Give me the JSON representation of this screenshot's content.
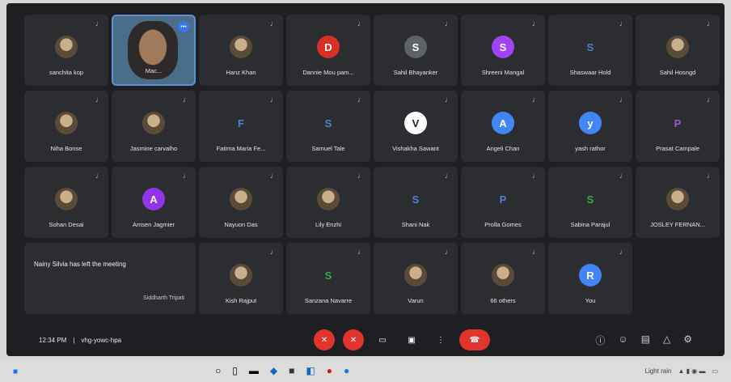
{
  "tiles": [
    {
      "name": "sanchita kop",
      "avatar": "",
      "kind": "photo"
    },
    {
      "name": "Mac...",
      "avatar": "",
      "kind": "self"
    },
    {
      "name": "Hanz Khan",
      "avatar": "",
      "kind": "photo"
    },
    {
      "name": "Dannie Mou pam...",
      "avatar": "D",
      "color": "#d93025"
    },
    {
      "name": "Sahil Bhayanker",
      "avatar": "S",
      "color": "#5f6368"
    },
    {
      "name": "Shreeni Mangal",
      "avatar": "S",
      "color": "#a142f4"
    },
    {
      "name": "Shaswaar Hold",
      "avatar": "S",
      "kind": "plain"
    },
    {
      "name": "Sahil Hosngd",
      "avatar": "",
      "kind": "photo"
    },
    {
      "name": "Niha Bonse",
      "avatar": "",
      "kind": "photo"
    },
    {
      "name": "Jasmine carvalho",
      "avatar": "",
      "kind": "photo"
    },
    {
      "name": "Fatima Maria Fe...",
      "avatar": "F",
      "kind": "plain"
    },
    {
      "name": "Samuel Tale",
      "avatar": "S",
      "kind": "plain"
    },
    {
      "name": "Vishakha Sawant",
      "avatar": "V",
      "color": "#ffffff",
      "textColor": "#222"
    },
    {
      "name": "Angeli Chan",
      "avatar": "A",
      "color": "#4285f4"
    },
    {
      "name": "yash rathor",
      "avatar": "y",
      "color": "#4285f4"
    },
    {
      "name": "Prasat Campale",
      "avatar": "P",
      "kind": "plain",
      "textColor": "#9b59d6"
    },
    {
      "name": "Sohan Desai",
      "avatar": "",
      "kind": "photo"
    },
    {
      "name": "Amsen Jagmier",
      "avatar": "A",
      "color": "#9334e6"
    },
    {
      "name": "Nayuon Das",
      "avatar": "",
      "kind": "photo"
    },
    {
      "name": "Lily Enzhi",
      "avatar": "",
      "kind": "photo"
    },
    {
      "name": "Shani Nak",
      "avatar": "S",
      "kind": "plain"
    },
    {
      "name": "Prolla Gomes",
      "avatar": "P",
      "kind": "plain"
    },
    {
      "name": "Sabina Parajul",
      "avatar": "S",
      "kind": "plain",
      "textColor": "#34a853"
    },
    {
      "name": "JOSLEY FERNAN...",
      "avatar": "",
      "kind": "photo"
    },
    {
      "name": "Kish Rajput",
      "avatar": "",
      "kind": "photo"
    },
    {
      "name": "Sanzana Navarre",
      "avatar": "S",
      "kind": "plain",
      "textColor": "#34a853"
    },
    {
      "name": "Varun",
      "avatar": "",
      "kind": "photo"
    },
    {
      "name": "66 others",
      "avatar": "",
      "kind": "photo"
    },
    {
      "name": "You",
      "avatar": "R",
      "color": "#4285f4"
    }
  ],
  "notice": {
    "message": "Nainy Silvia has left the meeting",
    "sub": "Siddharth Tripati"
  },
  "bottom": {
    "time": "12:34 PM",
    "separator": "|",
    "code": "vhg-yowc-hpa"
  },
  "taskbar": {
    "status": "Light rain"
  }
}
